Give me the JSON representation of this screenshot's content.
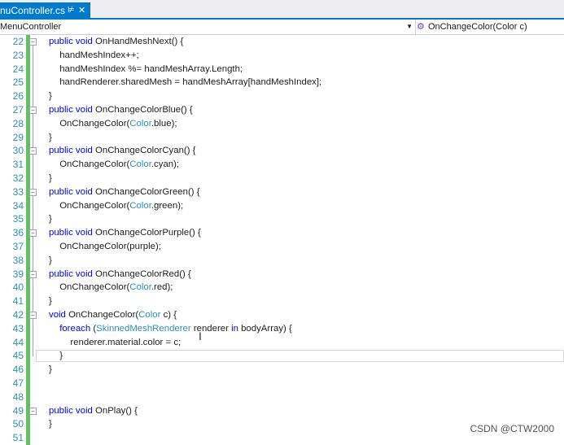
{
  "tab": {
    "label": "nuController.cs",
    "pin": "⊭",
    "close": "✕"
  },
  "navbar": {
    "type_scope": "MenuController",
    "member_scope": "OnChangeColor(Color c)"
  },
  "lines": [
    {
      "n": "22",
      "indent": 0,
      "fold": "−",
      "parts": [
        {
          "t": "public void ",
          "c": "kw"
        },
        {
          "t": "OnHandMeshNext() {",
          "c": ""
        }
      ]
    },
    {
      "n": "23",
      "indent": 1,
      "parts": [
        {
          "t": "handMeshIndex++;",
          "c": ""
        }
      ]
    },
    {
      "n": "24",
      "indent": 1,
      "parts": [
        {
          "t": "handMeshIndex %= handMeshArray.Length;",
          "c": ""
        }
      ]
    },
    {
      "n": "25",
      "indent": 1,
      "parts": [
        {
          "t": "handRenderer.sharedMesh = handMeshArray[handMeshIndex];",
          "c": ""
        }
      ]
    },
    {
      "n": "26",
      "indent": 0,
      "parts": [
        {
          "t": "}",
          "c": ""
        }
      ]
    },
    {
      "n": "27",
      "indent": 0,
      "fold": "−",
      "parts": [
        {
          "t": "public void ",
          "c": "kw"
        },
        {
          "t": "OnChangeColorBlue() {",
          "c": ""
        }
      ]
    },
    {
      "n": "28",
      "indent": 1,
      "parts": [
        {
          "t": "OnChangeColor(",
          "c": ""
        },
        {
          "t": "Color",
          "c": "ty"
        },
        {
          "t": ".blue);",
          "c": ""
        }
      ]
    },
    {
      "n": "29",
      "indent": 0,
      "parts": [
        {
          "t": "}",
          "c": ""
        }
      ]
    },
    {
      "n": "30",
      "indent": 0,
      "fold": "−",
      "parts": [
        {
          "t": "public void ",
          "c": "kw"
        },
        {
          "t": "OnChangeColorCyan() {",
          "c": ""
        }
      ]
    },
    {
      "n": "31",
      "indent": 1,
      "parts": [
        {
          "t": "OnChangeColor(",
          "c": ""
        },
        {
          "t": "Color",
          "c": "ty"
        },
        {
          "t": ".cyan);",
          "c": ""
        }
      ]
    },
    {
      "n": "32",
      "indent": 0,
      "parts": [
        {
          "t": "}",
          "c": ""
        }
      ]
    },
    {
      "n": "33",
      "indent": 0,
      "fold": "−",
      "parts": [
        {
          "t": "public void ",
          "c": "kw"
        },
        {
          "t": "OnChangeColorGreen() {",
          "c": ""
        }
      ]
    },
    {
      "n": "34",
      "indent": 1,
      "parts": [
        {
          "t": "OnChangeColor(",
          "c": ""
        },
        {
          "t": "Color",
          "c": "ty"
        },
        {
          "t": ".green);",
          "c": ""
        }
      ]
    },
    {
      "n": "35",
      "indent": 0,
      "parts": [
        {
          "t": "}",
          "c": ""
        }
      ]
    },
    {
      "n": "36",
      "indent": 0,
      "fold": "−",
      "parts": [
        {
          "t": "public void ",
          "c": "kw"
        },
        {
          "t": "OnChangeColorPurple() {",
          "c": ""
        }
      ]
    },
    {
      "n": "37",
      "indent": 1,
      "parts": [
        {
          "t": "OnChangeColor(purple);",
          "c": ""
        }
      ]
    },
    {
      "n": "38",
      "indent": 0,
      "parts": [
        {
          "t": "}",
          "c": ""
        }
      ]
    },
    {
      "n": "39",
      "indent": 0,
      "fold": "−",
      "parts": [
        {
          "t": "public void ",
          "c": "kw"
        },
        {
          "t": "OnChangeColorRed() {",
          "c": ""
        }
      ]
    },
    {
      "n": "40",
      "indent": 1,
      "parts": [
        {
          "t": "OnChangeColor(",
          "c": ""
        },
        {
          "t": "Color",
          "c": "ty"
        },
        {
          "t": ".red);",
          "c": ""
        }
      ]
    },
    {
      "n": "41",
      "indent": 0,
      "parts": [
        {
          "t": "}",
          "c": ""
        }
      ]
    },
    {
      "n": "42",
      "indent": 0,
      "fold": "−",
      "parts": [
        {
          "t": "void ",
          "c": "kw"
        },
        {
          "t": "OnChangeColor(",
          "c": ""
        },
        {
          "t": "Color",
          "c": "ty"
        },
        {
          "t": " c) {",
          "c": ""
        }
      ]
    },
    {
      "n": "43",
      "indent": 1,
      "parts": [
        {
          "t": "foreach",
          "c": "kw"
        },
        {
          "t": " (",
          "c": ""
        },
        {
          "t": "SkinnedMeshRenderer",
          "c": "ty"
        },
        {
          "t": " renderer ",
          "c": ""
        },
        {
          "t": "in",
          "c": "kw"
        },
        {
          "t": " bodyArray) {",
          "c": ""
        }
      ]
    },
    {
      "n": "44",
      "indent": 2,
      "parts": [
        {
          "t": "renderer.material.color = c;",
          "c": ""
        }
      ]
    },
    {
      "n": "45",
      "indent": 1,
      "current": true,
      "parts": [
        {
          "t": "}",
          "c": ""
        }
      ]
    },
    {
      "n": "46",
      "indent": 0,
      "parts": [
        {
          "t": "}",
          "c": ""
        }
      ]
    },
    {
      "n": "47",
      "indent": 0,
      "parts": []
    },
    {
      "n": "48",
      "indent": 0,
      "parts": []
    },
    {
      "n": "49",
      "indent": 0,
      "fold": "−",
      "parts": [
        {
          "t": "public void ",
          "c": "kw"
        },
        {
          "t": "OnPlay() {",
          "c": ""
        }
      ]
    },
    {
      "n": "50",
      "indent": 0,
      "parts": [
        {
          "t": "}",
          "c": ""
        }
      ]
    },
    {
      "n": "51",
      "indent": 0,
      "parts": []
    }
  ],
  "watermark": "CSDN @CTW2000",
  "colors": {
    "accent": "#007acc",
    "keyword": "#0000ff",
    "type": "#2b91af",
    "line_number": "#2b91af",
    "change_bar": "#5fc15f"
  }
}
